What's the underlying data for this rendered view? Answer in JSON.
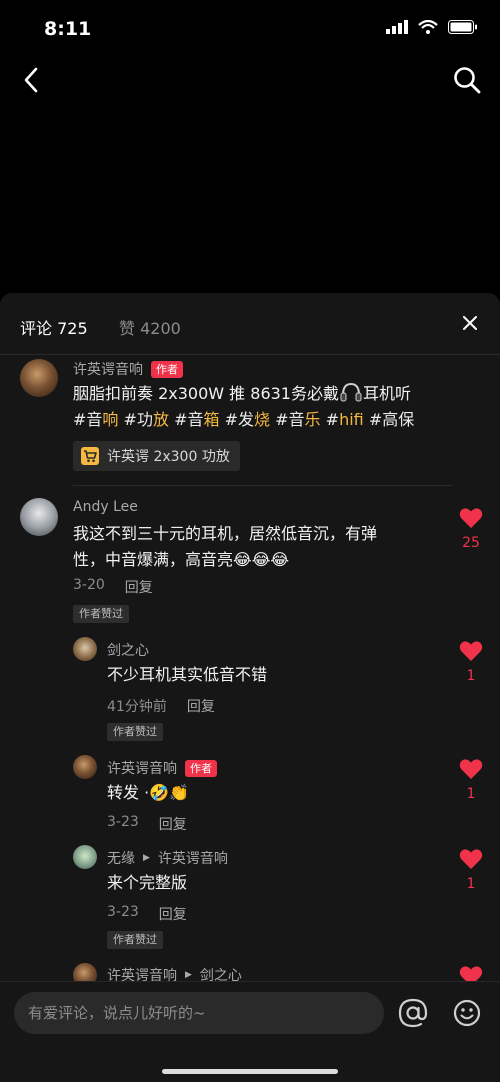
{
  "status_bar": {
    "time": "8:11"
  },
  "sheet": {
    "tab_comments": "评论 725",
    "tab_likes": "赞 4200"
  },
  "comments": [
    {
      "author": "许英谔音响",
      "badge": "作者",
      "text_line1": "胭脂扣前奏 2x300W 推 8631务必戴",
      "text_line1_end": "耳机听",
      "tags": [
        {
          "pre": "#音",
          "hl": "响"
        },
        {
          "pre": "#功",
          "hl": "放"
        },
        {
          "pre": "#音",
          "hl": "箱"
        },
        {
          "pre": "#发",
          "hl": "烧"
        },
        {
          "pre": "#音",
          "hl": "乐"
        },
        {
          "pre": "#",
          "hl": "hifi"
        },
        {
          "pre": "#高保",
          "hl": ""
        }
      ],
      "product": "许英谔 2x300 功放"
    },
    {
      "author": "Andy Lee",
      "text_line1": "我这不到三十元的耳机，居然低音沉，有弹",
      "text_line2": "性，中音爆满，高音亮",
      "date": "3-20",
      "reply": "回复",
      "liked_tag": "作者赞过",
      "likes": "25"
    },
    {
      "author": "剑之心",
      "text": "不少耳机其实低音不错",
      "date": "41分钟前",
      "reply": "回复",
      "liked_tag": "作者赞过",
      "likes": "1"
    },
    {
      "author": "许英谔音响",
      "badge": "作者",
      "text": "转发 ·",
      "date": "3-23",
      "reply": "回复",
      "likes": "1"
    },
    {
      "author": "无缘",
      "reply_to": "许英谔音响",
      "text": "来个完整版",
      "date": "3-23",
      "reply": "回复",
      "liked_tag": "作者赞过",
      "likes": "1"
    },
    {
      "author": "许英谔音响",
      "reply_to": "剑之心"
    }
  ],
  "input": {
    "placeholder": "有爱评论，说点儿好听的~"
  },
  "colors": {
    "accent_red": "#f0324b",
    "highlight": "#f5b942",
    "sheet_bg": "#161616"
  }
}
